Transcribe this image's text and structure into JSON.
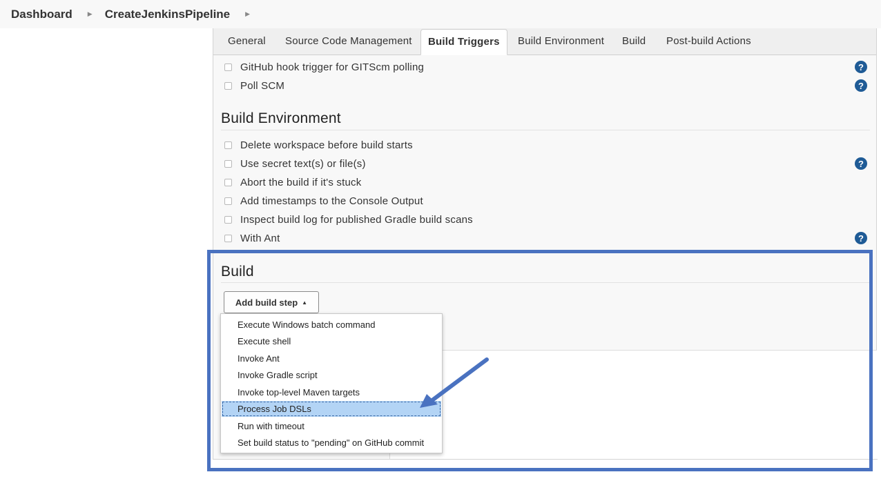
{
  "breadcrumb": {
    "items": [
      "Dashboard",
      "CreateJenkinsPipeline"
    ]
  },
  "tabs": [
    {
      "label": "General"
    },
    {
      "label": "Source Code Management"
    },
    {
      "label": "Build Triggers",
      "active": true
    },
    {
      "label": "Build Environment"
    },
    {
      "label": "Build"
    },
    {
      "label": "Post-build Actions"
    }
  ],
  "build_triggers": {
    "options": [
      {
        "label": "GitHub hook trigger for GITScm polling",
        "checked": false
      },
      {
        "label": "Poll SCM",
        "checked": false
      }
    ]
  },
  "build_environment": {
    "title": "Build Environment",
    "options": [
      {
        "label": "Delete workspace before build starts",
        "checked": false
      },
      {
        "label": "Use secret text(s) or file(s)",
        "checked": false
      },
      {
        "label": "Abort the build if it's stuck",
        "checked": false
      },
      {
        "label": "Add timestamps to the Console Output",
        "checked": false
      },
      {
        "label": "Inspect build log for published Gradle build scans",
        "checked": false
      },
      {
        "label": "With Ant",
        "checked": false
      }
    ]
  },
  "build": {
    "title": "Build",
    "add_step_label": "Add build step",
    "menu": {
      "items": [
        "Execute Windows batch command",
        "Execute shell",
        "Invoke Ant",
        "Invoke Gradle script",
        "Invoke top-level Maven targets",
        "Process Job DSLs",
        "Run with timeout",
        "Set build status to \"pending\" on GitHub commit"
      ],
      "selected": "Process Job DSLs"
    }
  },
  "icons": {
    "help": "help-icon",
    "breadcrumb_separator": "chevron-right-icon",
    "dropdown_caret": "caret-up-icon"
  },
  "colors": {
    "highlight": "#4a72c0",
    "help_icon": "#1f5b96",
    "selected_item": "#b3d4f5"
  },
  "help_glyph": "?"
}
